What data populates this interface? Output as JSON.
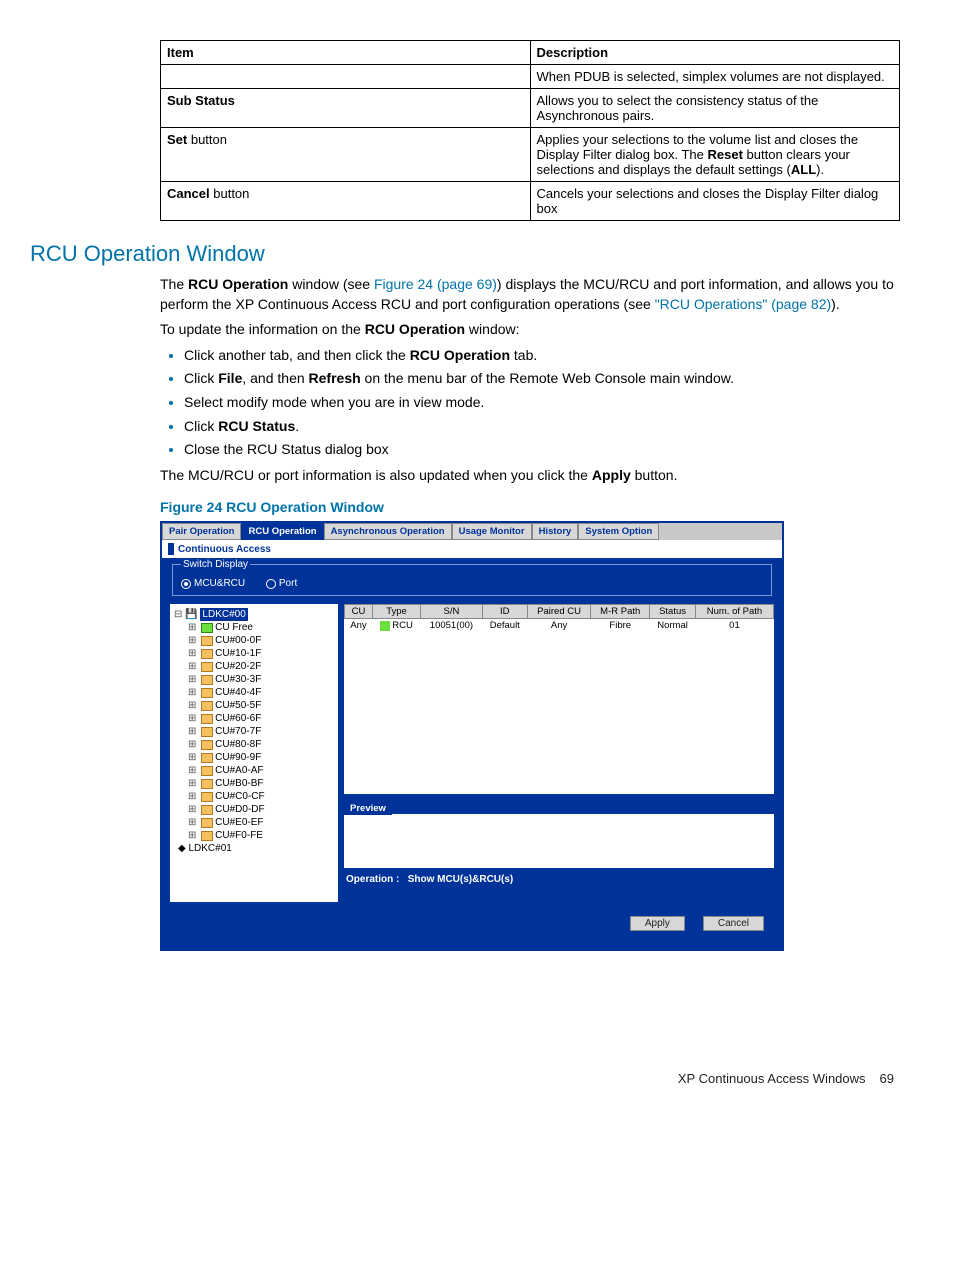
{
  "table": {
    "head_item": "Item",
    "head_desc": "Description",
    "row1_desc": "When PDUB is selected, simplex volumes are not displayed.",
    "row2_item": "Sub Status",
    "row2_desc": "Allows you to select the consistency status of the Asynchronous pairs.",
    "row3_item_bold": "Set",
    "row3_item_rest": " button",
    "row3_desc_a": "Applies your selections to the volume list and closes the Display Filter dialog box. The ",
    "row3_desc_bold1": "Reset",
    "row3_desc_b": " button clears your selections and displays the default settings (",
    "row3_desc_bold2": "ALL",
    "row3_desc_c": ").",
    "row4_item_bold": "Cancel",
    "row4_item_rest": " button",
    "row4_desc": "Cancels your selections and closes the Display Filter dialog box"
  },
  "heading": "RCU Operation Window",
  "intro": {
    "a": "The ",
    "b": "RCU Operation",
    "c": " window (see ",
    "link1": "Figure 24 (page 69)",
    "d": ") displays the MCU/RCU and port information, and allows you to perform the XP Continuous Access RCU and port configuration operations (see ",
    "link2": "\"RCU Operations\" (page 82)",
    "e": ")."
  },
  "update_line_a": "To update the information on the ",
  "update_line_b": "RCU Operation",
  "update_line_c": " window:",
  "steps": {
    "s1a": "Click another tab, and then click the ",
    "s1b": "RCU Operation",
    "s1c": " tab.",
    "s2a": "Click ",
    "s2b": "File",
    "s2c": ", and then ",
    "s2d": "Refresh",
    "s2e": " on the menu bar of the Remote Web Console main window.",
    "s3": "Select modify mode when you are in view mode.",
    "s4a": "Click ",
    "s4b": "RCU Status",
    "s4c": ".",
    "s5": "Close the RCU Status dialog box"
  },
  "post_a": "The MCU/RCU or port information is also updated when you click the ",
  "post_b": "Apply",
  "post_c": " button.",
  "figure_caption": "Figure 24 RCU Operation Window",
  "app": {
    "tabs": [
      "Pair Operation",
      "RCU Operation",
      "Asynchronous Operation",
      "Usage Monitor",
      "History",
      "System Option"
    ],
    "title": "Continuous Access",
    "switch_legend": "Switch Display",
    "radio1": "MCU&RCU",
    "radio2": "Port",
    "tree": {
      "root": "LDKC#00",
      "cu_free": "CU Free",
      "items": [
        "CU#00-0F",
        "CU#10-1F",
        "CU#20-2F",
        "CU#30-3F",
        "CU#40-4F",
        "CU#50-5F",
        "CU#60-6F",
        "CU#70-7F",
        "CU#80-8F",
        "CU#90-9F",
        "CU#A0-AF",
        "CU#B0-BF",
        "CU#C0-CF",
        "CU#D0-DF",
        "CU#E0-EF",
        "CU#F0-FE"
      ],
      "sibling": "LDKC#01"
    },
    "grid": {
      "headers": [
        "CU",
        "Type",
        "S/N",
        "ID",
        "Paired CU",
        "M-R Path",
        "Status",
        "Num. of Path"
      ],
      "row": [
        "Any",
        "RCU",
        "10051(00)",
        "Default",
        "Any",
        "Fibre",
        "Normal",
        "01"
      ]
    },
    "preview_label": "Preview",
    "op_label": "Operation :",
    "op_value": "Show MCU(s)&RCU(s)",
    "btn_apply": "Apply",
    "btn_cancel": "Cancel"
  },
  "footer_text": "XP Continuous Access Windows",
  "footer_page": "69"
}
